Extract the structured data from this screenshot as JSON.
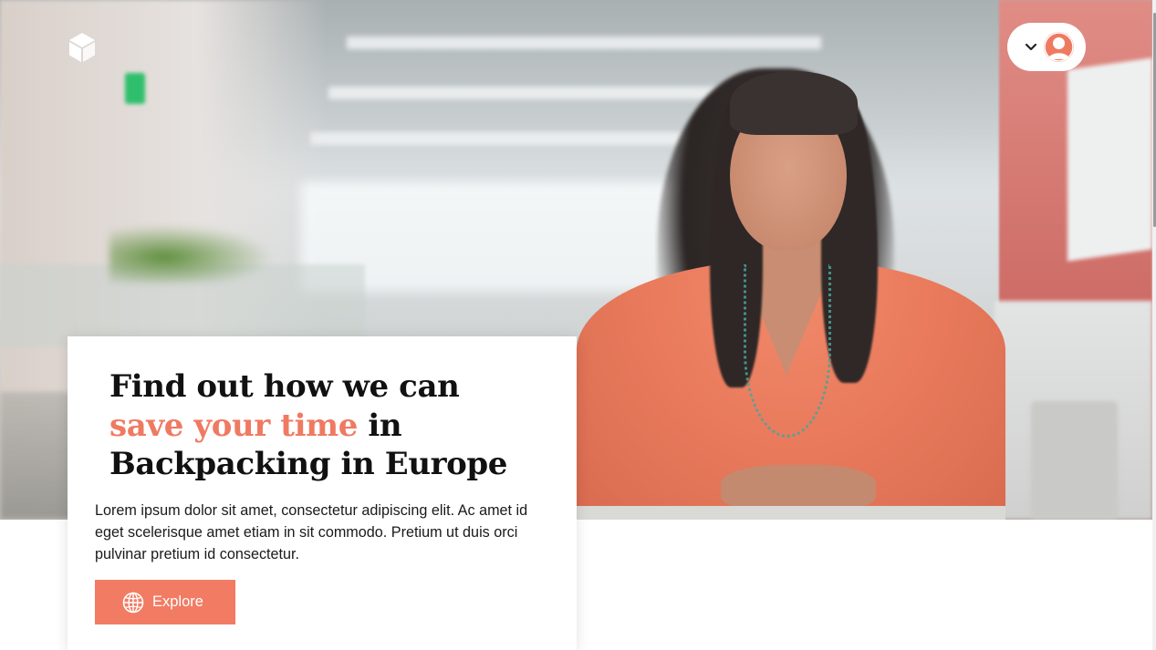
{
  "header": {
    "logo_icon": "cube-icon",
    "account_menu": {
      "chevron_icon": "chevron-down-icon",
      "avatar_icon": "user-avatar-icon"
    }
  },
  "hero": {
    "image": "woman-in-office-photo"
  },
  "card": {
    "headline_part1": "Find out how we can ",
    "headline_accent": "save your time",
    "headline_part2": " in Backpacking in Europe",
    "body": "Lorem ipsum dolor sit amet, consectetur adipiscing elit. Ac amet id eget scelerisque amet etiam in sit commodo. Pretium ut duis orci pulvinar pretium id consectetur.",
    "button_label": "Explore",
    "button_icon": "globe-icon"
  },
  "colors": {
    "accent": "#ef7a62",
    "button": "#f27b63",
    "text": "#111111",
    "card_bg": "#ffffff"
  }
}
